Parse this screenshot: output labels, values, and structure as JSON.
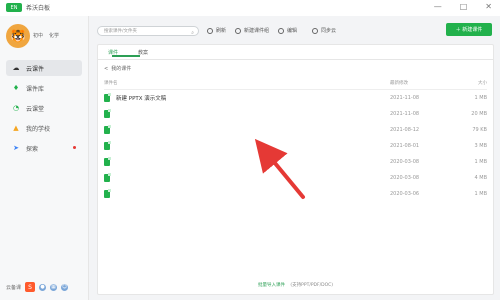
{
  "app": {
    "title": "希沃白板",
    "brand_short": "EN"
  },
  "window_controls": {
    "minimize": "—",
    "maximize": "□",
    "close": "✕"
  },
  "profile": {
    "avatar_emoji": "🐯",
    "org": "初中",
    "class": "化学"
  },
  "sidebar": {
    "items": [
      {
        "label": "云课件"
      },
      {
        "label": "课件库"
      },
      {
        "label": "云课堂"
      },
      {
        "label": "我的学校"
      },
      {
        "label": "探索"
      }
    ],
    "tools_label": "云备课"
  },
  "toolbar": {
    "search_placeholder": "搜索课件/文件夹",
    "refresh_label": "刷新",
    "new_folder_label": "新建课件组",
    "edit_label": "编辑",
    "sync_label": "同步云",
    "new_button_label": "＋ 新建课件"
  },
  "tabs": [
    {
      "label": "课件"
    },
    {
      "label": "教案"
    }
  ],
  "breadcrumb": {
    "back_label": "<",
    "current_label": "我的课件"
  },
  "table": {
    "headers": [
      "课件名",
      "最新修改",
      "大小"
    ],
    "rows": [
      {
        "name": "新建 PPTX 演示文稿",
        "date": "2021-11-08",
        "size": "1 MB"
      },
      {
        "name": "",
        "date": "2021-11-08",
        "size": "20 MB"
      },
      {
        "name": "",
        "date": "2021-08-12",
        "size": "79 KB"
      },
      {
        "name": "",
        "date": "2021-08-01",
        "size": "3 MB"
      },
      {
        "name": "",
        "date": "2020-03-08",
        "size": "1 MB"
      },
      {
        "name": "",
        "date": "2020-03-08",
        "size": "4 MB"
      },
      {
        "name": "",
        "date": "2020-03-06",
        "size": "1 MB"
      }
    ]
  },
  "footer": {
    "link_label": "批量导入课件",
    "note": "(支持PPT/PDF/DOC)"
  },
  "colors": {
    "accent": "#22b14c",
    "arrow": "#e53935"
  }
}
